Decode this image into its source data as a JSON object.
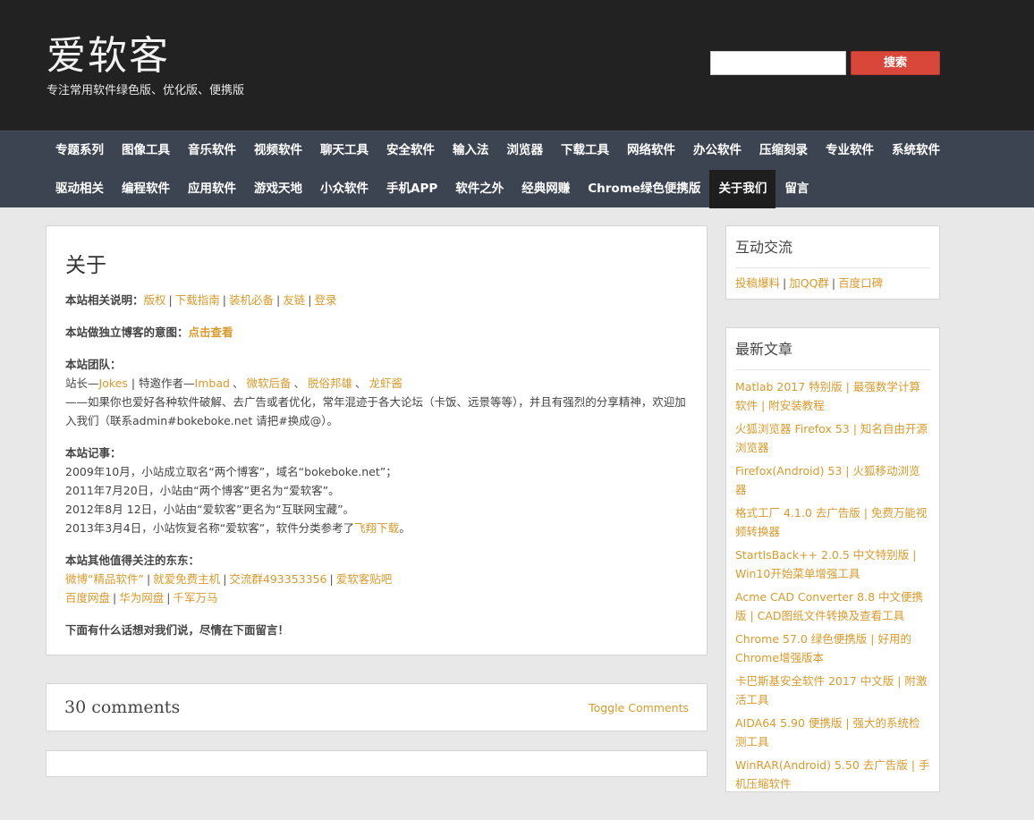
{
  "header": {
    "title": "爱软客",
    "tagline": "专注常用软件绿色版、优化版、便携版",
    "search_button": "搜索"
  },
  "nav": {
    "row1": [
      "专题系列",
      "图像工具",
      "音乐软件",
      "视频软件",
      "聊天工具",
      "安全软件",
      "输入法",
      "浏览器",
      "下载工具",
      "网络软件",
      "办公软件",
      "压缩刻录",
      "专业软件",
      "系统软件"
    ],
    "row2": [
      "驱动相关",
      "编程软件",
      "应用软件",
      "游戏天地",
      "小众软件",
      "手机APP",
      "软件之外",
      "经典网赚",
      "Chrome绿色便携版",
      "关于我们",
      "留言"
    ],
    "active": "关于我们"
  },
  "article": {
    "title": "关于",
    "p1_label": "本站相关说明：",
    "p1_links": [
      "版权",
      "下载指南",
      "装机必备",
      "友链",
      "登录"
    ],
    "p2_label": "本站做独立博客的意图：",
    "p2_link": "点击查看",
    "team_label": "本站团队：",
    "team_prefix": "站长—",
    "team_owner": "Jokes",
    "team_mid": " | 特邀作者—",
    "team_authors": [
      "Imbad",
      "微软后备",
      "脱俗邦雄",
      "龙虾酱"
    ],
    "team_note": "——如果你也爱好各种软件破解、去广告或者优化，常年混迹于各大论坛（卡饭、远景等等），并且有强烈的分享精神，欢迎加入我们（联系admin#bokeboke.net 请把#换成@）。",
    "history_label": "本站记事：",
    "history": [
      "2009年10月，小站成立取名“两个博客”，域名“bokeboke.net”；",
      "2011年7月20日，小站由“两个博客”更名为“爱软客”。",
      "2012年8月 12日，小站由“爱软客”更名为“互联网宝藏”。"
    ],
    "history_last_prefix": "2013年3月4日，小站恢复名称“爱软客”，软件分类参考了",
    "history_last_link": "飞翔下载",
    "history_last_suffix": "。",
    "other_label": "本站其他值得关注的东东：",
    "other_row1": [
      "微博“精品软件”",
      "就爱免费主机",
      "交流群493353356",
      "爱软客贴吧"
    ],
    "other_row2": [
      "百度网盘",
      "华为网盘",
      "千军万马"
    ],
    "closing": "下面有什么话想对我们说，尽情在下面留言！"
  },
  "comments": {
    "count_label": "30 comments",
    "toggle_label": "Toggle Comments"
  },
  "sidebar": {
    "interact_title": "互动交流",
    "interact_links": [
      "投稿爆料",
      "加QQ群",
      "百度口碑"
    ],
    "latest_title": "最新文章",
    "latest_posts": [
      "Matlab 2017 特别版 | 最强数学计算软件 | 附安装教程",
      "火狐浏览器 Firefox 53 | 知名自由开源浏览器",
      "Firefox(Android) 53 | 火狐移动浏览器",
      "格式工厂 4.1.0 去广告版 | 免费万能视频转换器",
      "StartIsBack++ 2.0.5 中文特别版 | Win10开始菜单增强工具",
      "Acme CAD Converter 8.8 中文便携版 | CAD图纸文件转换及查看工具",
      "Chrome 57.0 绿色便携版 | 好用的Chrome增强版本",
      "卡巴斯基安全软件 2017 中文版 | 附激活工具",
      "AIDA64 5.90 便携版 | 强大的系统检测工具",
      "WinRAR(Android) 5.50 去广告版 | 手机压缩软件"
    ]
  }
}
